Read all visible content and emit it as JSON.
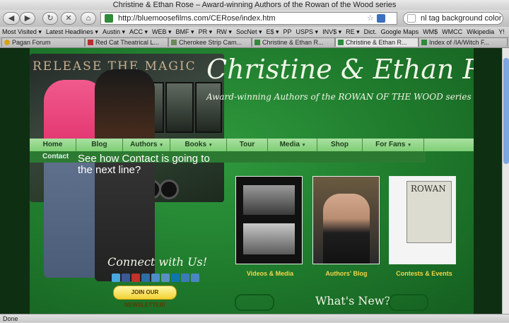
{
  "window": {
    "title": "Christine & Ethan Rose – Award-winning Authors of the Rowan of the Wood series"
  },
  "toolbar": {
    "back_label": "◀",
    "forward_label": "▶",
    "reload_label": "↻",
    "stop_label": "✕",
    "home_label": "⌂",
    "url": "http://bluemoosefilms.com/CERose/index.htm",
    "search_value": "nl tag background color"
  },
  "bookmarks": [
    "Most Visited ▾",
    "Latest Headlines ▾",
    "Austin ▾",
    "ACC ▾",
    "WEB ▾",
    "BMF ▾",
    "PR ▾",
    "RW ▾",
    "SocNet ▾",
    "E$ ▾",
    "PP",
    "USPS ▾",
    "INV$ ▾",
    "RE ▾",
    "Dict.",
    "Google Maps",
    "WM$",
    "WMCC",
    "Wikipedia",
    "Y!"
  ],
  "tabs": [
    "Pagan Forum",
    "Red Cat Theatrical L...",
    "Cherokee Strip Cam...",
    "Christine & Ethan R...",
    "Christine & Ethan R...",
    "Index of /IA/Witch F..."
  ],
  "site": {
    "trailer_text": "RELEASE THE MAGIC",
    "title": "Christine & Ethan Rose",
    "tagline": "Award-winning Authors of the ROWAN OF THE WOOD series",
    "menu": [
      {
        "label": "Home",
        "arrow": ""
      },
      {
        "label": "Blog",
        "arrow": ""
      },
      {
        "label": "Authors",
        "arrow": "▾"
      },
      {
        "label": "Books",
        "arrow": "▾"
      },
      {
        "label": "Tour",
        "arrow": ""
      },
      {
        "label": "Media",
        "arrow": "▾"
      },
      {
        "label": "Shop",
        "arrow": ""
      },
      {
        "label": "For Fans",
        "arrow": "▾"
      }
    ],
    "submenu_item": "Contact",
    "note": "See how Contact is going to the next line?",
    "cards": [
      "Videos & Media",
      "Authors' Blog",
      "Contests & Events"
    ],
    "book_cover_text": "ROWAN",
    "connect_title": "Connect with Us!",
    "newsletter_label": "JOIN OUR NEWSLETTER!",
    "whats_new": "What's New?"
  },
  "status": {
    "text": "Done"
  },
  "colors": {
    "site_green": "#1f7a2c",
    "menu_green": "#a9e0a0",
    "label_yellow": "#f3d64a"
  }
}
